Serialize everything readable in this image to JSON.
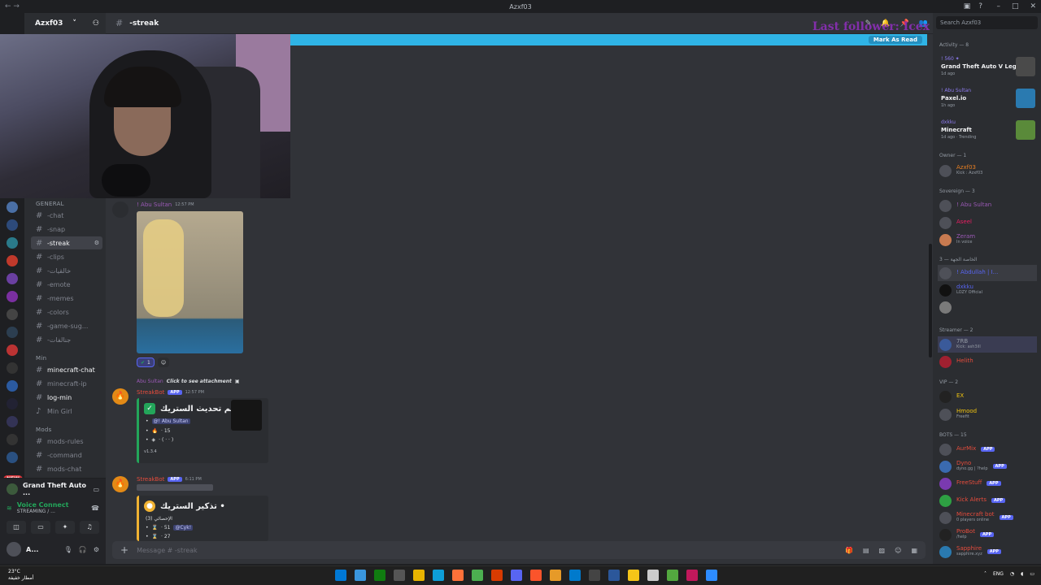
{
  "window": {
    "title": "Azxf03",
    "nav": "← →"
  },
  "server": {
    "name": "Azxf03",
    "new_badge": "NEW"
  },
  "channel": {
    "name": "-streak"
  },
  "overlay": {
    "text": "Last follower: Icex"
  },
  "banner": {
    "mark_read": "Mark As Read"
  },
  "categories": [
    {
      "label": "GENERAL"
    },
    {
      "label": "Min"
    },
    {
      "label": "Mods"
    }
  ],
  "channels": [
    {
      "label": "-chat"
    },
    {
      "label": "-snap"
    },
    {
      "label": "-streak"
    },
    {
      "label": "-clips"
    },
    {
      "label": "-خالقيات"
    },
    {
      "label": "-emote"
    },
    {
      "label": "-memes"
    },
    {
      "label": "-colors"
    },
    {
      "label": "-game-sug..."
    },
    {
      "label": "-جنالفات"
    },
    {
      "label": "minecraft-chat"
    },
    {
      "label": "minecraft-ip"
    },
    {
      "label": "log-min"
    },
    {
      "label": "Min Girl"
    },
    {
      "label": "mods-rules"
    },
    {
      "label": "-command"
    },
    {
      "label": "mods-chat"
    }
  ],
  "voice": {
    "game": "Grand Theft Auto ...",
    "connected": "Voice Connect",
    "status": "STREAMING / ..."
  },
  "user": {
    "name": "A..."
  },
  "messages": {
    "m1": {
      "author": "! Abu Sultan",
      "time": "12:57 PM",
      "reaction_count": "1"
    },
    "m2": {
      "reply_author": "Abu Sultan",
      "reply_text": "Click to see attachment",
      "author": "StreakBot",
      "app": "APP",
      "time": "12:57 PM",
      "title": "تم تحديث الستريك •",
      "mention": "@! Abu Sultan",
      "streak": "· 15",
      "extra": "· (  ·  ·  )",
      "footer": "v1.3.4"
    },
    "m3": {
      "author": "StreakBot",
      "app": "APP",
      "time": "6:11 PM",
      "title": "تذكير الستريك •",
      "sub": "الإحصائي (3)",
      "l1": "· 51",
      "l1_mention": "@Cyk!",
      "l2": "· 27"
    }
  },
  "composer": {
    "placeholder": "Message # -streak"
  },
  "members": {
    "search": "Search Azxf03",
    "activity_header": "Activity — 8",
    "activities": [
      {
        "who": "! 560 ✦",
        "game": "Grand Theft Auto V Lega...",
        "ago": "1d ago"
      },
      {
        "who": "! Abu Sultan",
        "game": "Paxel.io",
        "ago": "1h ago"
      },
      {
        "who": "dxkku",
        "game": "Minecraft",
        "ago": "1d ago · Trending"
      }
    ],
    "groups": [
      {
        "label": "Owner — 1"
      },
      {
        "label": "Sovereign — 3"
      },
      {
        "label": "الخاصة الجهة — 3"
      },
      {
        "label": "Streamer — 2"
      },
      {
        "label": "VIP — 2"
      },
      {
        "label": "BOTS — 15"
      }
    ],
    "list": [
      {
        "name": "Azxf03",
        "sub": "Kick : Azxf03",
        "color": "#e67e22"
      },
      {
        "name": "! Abu Sultan",
        "sub": "",
        "color": "#9b59b6"
      },
      {
        "name": "Aseel",
        "sub": "",
        "color": "#e91e63"
      },
      {
        "name": "Zeram",
        "sub": "In voice",
        "color": "#9b59b6"
      },
      {
        "name": "! Abdullah | I...",
        "sub": "",
        "color": "#5865f2"
      },
      {
        "name": "dxkku",
        "sub": "LOZY Official",
        "color": "#5865f2"
      },
      {
        "name": "",
        "sub": "",
        "color": "#5865f2"
      },
      {
        "name": "7RB",
        "sub": "Kick: ash3ill",
        "color": "#949ba4"
      },
      {
        "name": "Helith",
        "sub": "",
        "color": "#e74c3c"
      },
      {
        "name": "EX",
        "sub": "",
        "color": "#f1c40f"
      },
      {
        "name": "Hmood",
        "sub": "Freefit",
        "color": "#f1c40f"
      },
      {
        "name": "AurMix",
        "sub": "",
        "color": "#e74c3c"
      },
      {
        "name": "Dyno",
        "sub": "dyno.gg | ?help",
        "color": "#e74c3c"
      },
      {
        "name": "FreeStuff",
        "sub": "",
        "color": "#e74c3c"
      },
      {
        "name": "Kick Alerts",
        "sub": "",
        "color": "#e74c3c"
      },
      {
        "name": "Minecraft bot",
        "sub": "0 players online",
        "color": "#e74c3c"
      },
      {
        "name": "ProBot",
        "sub": "/help",
        "color": "#e74c3c"
      },
      {
        "name": "Sapphire",
        "sub": "sapphire.xyz",
        "color": "#e74c3c"
      }
    ]
  },
  "taskbar": {
    "temp": "23°C",
    "weather": "أمطار خفيفة",
    "lang": "ENG"
  },
  "colors": {
    "accent": "#5865f2",
    "banner": "#2fb4e6",
    "online": "#23a55a"
  }
}
